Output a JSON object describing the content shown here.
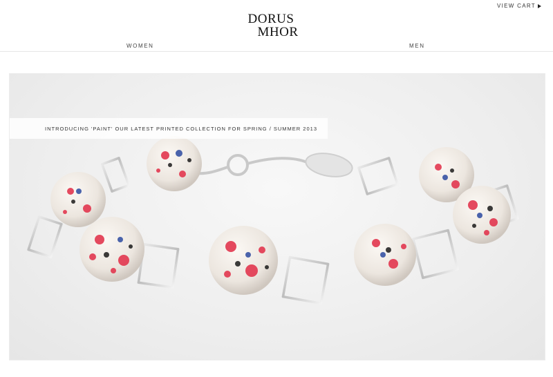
{
  "header": {
    "view_cart_label": "VIEW CART",
    "logo_line1": "DORUS",
    "logo_line2": "MHOR"
  },
  "nav": {
    "items": [
      {
        "label": "WOMEN"
      },
      {
        "label": "MEN"
      }
    ]
  },
  "hero": {
    "banner_text": "INTRODUCING 'PAINT' OUR LATEST PRINTED COLLECTION FOR SPRING / SUMMER 2013",
    "colors": {
      "bead_base": "#f1ece6",
      "splatter_red": "#e2374f",
      "splatter_blue": "#2c4aa0",
      "splatter_black": "#1a1a1a",
      "silver": "#c9c9c9"
    }
  },
  "icons": {
    "cart_arrow": "triangle-right-icon"
  }
}
